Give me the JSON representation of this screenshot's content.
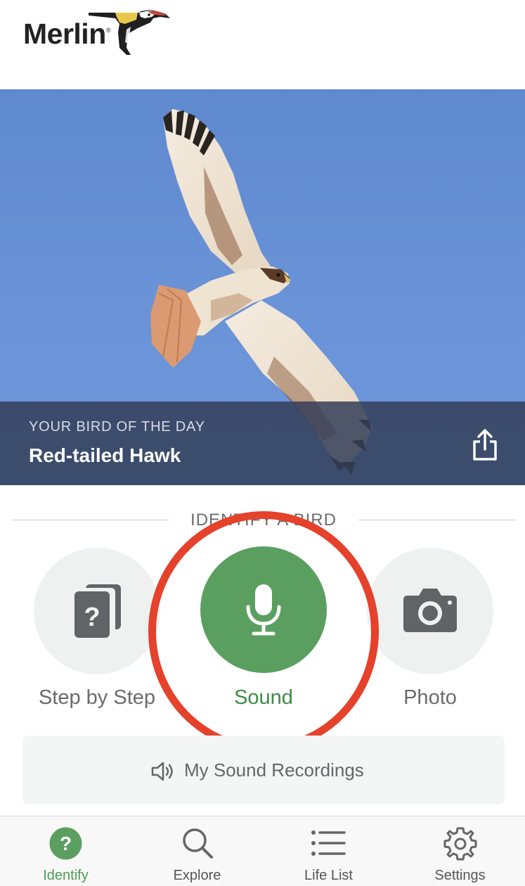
{
  "header": {
    "logo_text": "Merlin",
    "logo_reg": "®"
  },
  "hero": {
    "label": "YOUR BIRD OF THE DAY",
    "bird_name": "Red-tailed Hawk",
    "share_icon": "share-icon"
  },
  "identify": {
    "section_title": "IDENTIFY A BIRD",
    "step_label": "Step by Step",
    "sound_label": "Sound",
    "photo_label": "Photo",
    "recordings_label": "My Sound Recordings"
  },
  "tabs": [
    {
      "label": "Identify",
      "icon": "question-icon",
      "active": true
    },
    {
      "label": "Explore",
      "icon": "search-icon",
      "active": false
    },
    {
      "label": "Life List",
      "icon": "list-icon",
      "active": false
    },
    {
      "label": "Settings",
      "icon": "gear-icon",
      "active": false
    }
  ],
  "colors": {
    "accent_green": "#5b9f60",
    "annotation_red": "#e5412b",
    "caption_bg": "#343e58",
    "sky": "#6a93d8"
  }
}
